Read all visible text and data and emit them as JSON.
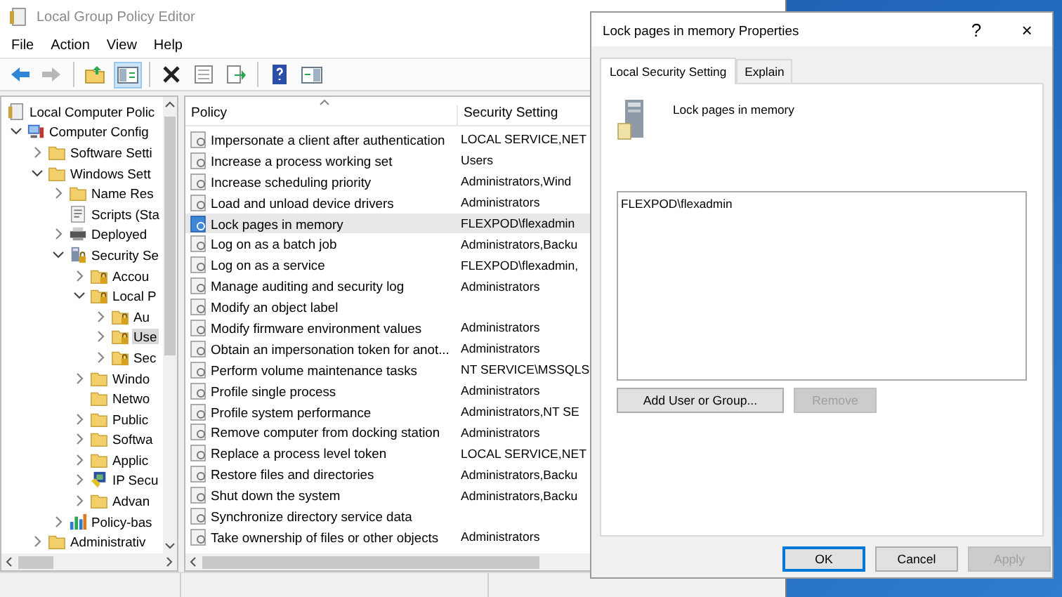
{
  "main_window": {
    "title": "Local Group Policy Editor",
    "menu": [
      "File",
      "Action",
      "View",
      "Help"
    ],
    "toolbar": [
      [
        {
          "kind": "back",
          "disabled": false,
          "pressed": false
        },
        {
          "kind": "forward",
          "disabled": true,
          "pressed": false
        }
      ],
      [
        {
          "kind": "up-folder",
          "disabled": false,
          "pressed": false
        },
        {
          "kind": "tree-pane",
          "disabled": false,
          "pressed": true
        }
      ],
      [
        {
          "kind": "delete",
          "disabled": false,
          "pressed": false
        },
        {
          "kind": "properties",
          "disabled": false,
          "pressed": false
        },
        {
          "kind": "export",
          "disabled": false,
          "pressed": false
        }
      ],
      [
        {
          "kind": "help",
          "disabled": false,
          "pressed": false
        },
        {
          "kind": "view",
          "disabled": false,
          "pressed": false
        }
      ]
    ],
    "tree": [
      {
        "label": "Local Computer Polic",
        "kind": "policy",
        "selected": false,
        "children": [
          {
            "label": "Computer Config",
            "kind": "computer",
            "expandable": true,
            "expanded": true,
            "selected": false,
            "children": [
              {
                "label": "Software Setti",
                "kind": "folder",
                "expandable": true,
                "expanded": false,
                "selected": false
              },
              {
                "label": "Windows Sett",
                "kind": "folder",
                "expandable": true,
                "expanded": true,
                "selected": false,
                "children": [
                  {
                    "label": "Name Res",
                    "kind": "folder",
                    "expandable": true,
                    "expanded": false,
                    "selected": false
                  },
                  {
                    "label": "Scripts (Sta",
                    "kind": "script",
                    "selected": false
                  },
                  {
                    "label": "Deployed",
                    "kind": "printer",
                    "expandable": true,
                    "expanded": false,
                    "selected": false
                  },
                  {
                    "label": "Security Se",
                    "kind": "security",
                    "expandable": true,
                    "expanded": true,
                    "selected": false,
                    "children": [
                      {
                        "label": "Accou",
                        "kind": "secure-folder",
                        "expandable": true,
                        "expanded": false,
                        "selected": false
                      },
                      {
                        "label": "Local P",
                        "kind": "secure-folder",
                        "expandable": true,
                        "expanded": true,
                        "selected": false,
                        "children": [
                          {
                            "label": "Au",
                            "kind": "secure-folder",
                            "expandable": true,
                            "expanded": false,
                            "selected": false
                          },
                          {
                            "label": "Use",
                            "kind": "secure-folder",
                            "expandable": true,
                            "expanded": false,
                            "selected": true
                          },
                          {
                            "label": "Sec",
                            "kind": "secure-folder",
                            "expandable": true,
                            "expanded": false,
                            "selected": false
                          }
                        ]
                      },
                      {
                        "label": "Windo",
                        "kind": "folder",
                        "expandable": true,
                        "expanded": false,
                        "selected": false
                      },
                      {
                        "label": "Netwo",
                        "kind": "folder",
                        "selected": false
                      },
                      {
                        "label": "Public",
                        "kind": "folder",
                        "expandable": true,
                        "expanded": false,
                        "selected": false
                      },
                      {
                        "label": "Softwa",
                        "kind": "folder",
                        "expandable": true,
                        "expanded": false,
                        "selected": false
                      },
                      {
                        "label": "Applic",
                        "kind": "folder",
                        "expandable": true,
                        "expanded": false,
                        "selected": false
                      },
                      {
                        "label": "IP Secu",
                        "kind": "network",
                        "expandable": true,
                        "expanded": false,
                        "selected": false
                      },
                      {
                        "label": "Advan",
                        "kind": "folder",
                        "expandable": true,
                        "expanded": false,
                        "selected": false
                      }
                    ]
                  },
                  {
                    "label": "Policy-bas",
                    "kind": "chart",
                    "expandable": true,
                    "expanded": false,
                    "selected": false
                  }
                ]
              },
              {
                "label": "Administrativ",
                "kind": "folder",
                "expandable": true,
                "expanded": false,
                "selected": false
              }
            ]
          }
        ]
      }
    ],
    "table": {
      "columns": [
        "Policy",
        "Security Setting"
      ],
      "rows": [
        {
          "policy": "Impersonate a client after authentication",
          "setting": "LOCAL SERVICE,NET",
          "selected": false
        },
        {
          "policy": "Increase a process working set",
          "setting": "Users",
          "selected": false
        },
        {
          "policy": "Increase scheduling priority",
          "setting": "Administrators,Wind",
          "selected": false
        },
        {
          "policy": "Load and unload device drivers",
          "setting": "Administrators",
          "selected": false
        },
        {
          "policy": "Lock pages in memory",
          "setting": "FLEXPOD\\flexadmin",
          "selected": true
        },
        {
          "policy": "Log on as a batch job",
          "setting": "Administrators,Backu",
          "selected": false
        },
        {
          "policy": "Log on as a service",
          "setting": "FLEXPOD\\flexadmin,",
          "selected": false
        },
        {
          "policy": "Manage auditing and security log",
          "setting": "Administrators",
          "selected": false
        },
        {
          "policy": "Modify an object label",
          "selected": false
        },
        {
          "policy": "Modify firmware environment values",
          "setting": "Administrators",
          "selected": false
        },
        {
          "policy": "Obtain an impersonation token for anot...",
          "setting": "Administrators",
          "selected": false
        },
        {
          "policy": "Perform volume maintenance tasks",
          "setting": "NT SERVICE\\MSSQLS",
          "selected": false
        },
        {
          "policy": "Profile single process",
          "setting": "Administrators",
          "selected": false
        },
        {
          "policy": "Profile system performance",
          "setting": "Administrators,NT SE",
          "selected": false
        },
        {
          "policy": "Remove computer from docking station",
          "setting": "Administrators",
          "selected": false
        },
        {
          "policy": "Replace a process level token",
          "setting": "LOCAL SERVICE,NET",
          "selected": false
        },
        {
          "policy": "Restore files and directories",
          "setting": "Administrators,Backu",
          "selected": false
        },
        {
          "policy": "Shut down the system",
          "setting": "Administrators,Backu",
          "selected": false
        },
        {
          "policy": "Synchronize directory service data",
          "selected": false
        },
        {
          "policy": "Take ownership of files or other objects",
          "setting": "Administrators",
          "selected": false
        }
      ]
    }
  },
  "dialog": {
    "title": "Lock pages in memory Properties",
    "help": "?",
    "close": "×",
    "tabs": [
      {
        "label": "Local Security Setting",
        "selected": true
      },
      {
        "label": "Explain",
        "selected": false
      }
    ],
    "heading": "Lock pages in memory",
    "members": [
      "FLEXPOD\\flexadmin"
    ],
    "member_buttons": [
      {
        "label": "Add User or Group...",
        "disabled": false
      },
      {
        "label": "Remove",
        "disabled": true
      }
    ],
    "buttons": [
      {
        "label": "OK",
        "disabled": false,
        "default": true
      },
      {
        "label": "Cancel",
        "disabled": false,
        "default": false
      },
      {
        "label": "Apply",
        "disabled": true,
        "default": false
      }
    ]
  }
}
